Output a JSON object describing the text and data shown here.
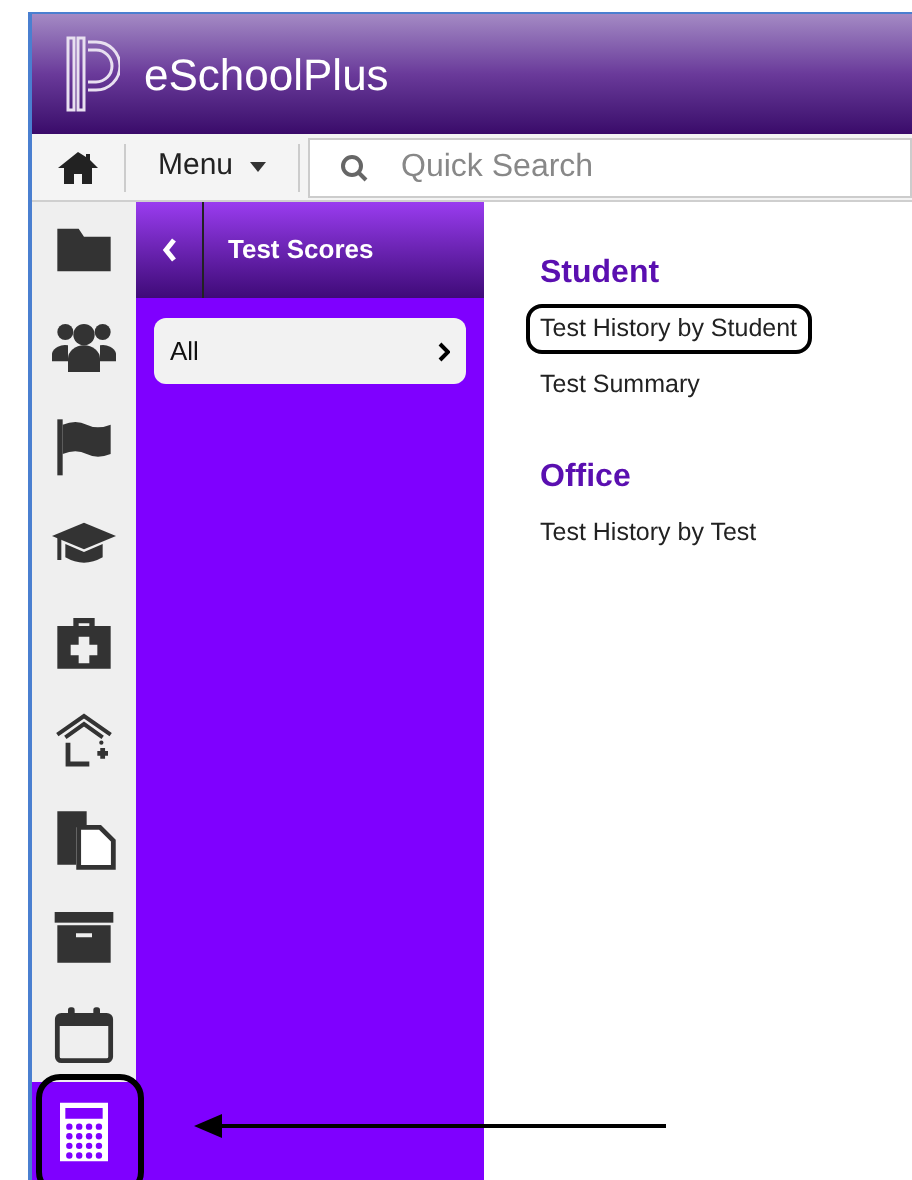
{
  "header": {
    "title": "eSchoolPlus"
  },
  "toolbar": {
    "menu_label": "Menu",
    "search": {
      "placeholder": "Quick Search"
    }
  },
  "sidebar": {
    "items": [
      {
        "kind": "folder",
        "selected": false
      },
      {
        "kind": "people",
        "selected": false
      },
      {
        "kind": "flag",
        "selected": false
      },
      {
        "kind": "cap",
        "selected": false
      },
      {
        "kind": "medkit",
        "selected": false
      },
      {
        "kind": "house",
        "selected": false
      },
      {
        "kind": "documents",
        "selected": false
      },
      {
        "kind": "archive",
        "selected": false
      },
      {
        "kind": "calendar",
        "selected": false
      },
      {
        "kind": "calculator",
        "selected": true,
        "circled": true
      }
    ]
  },
  "panel": {
    "title": "Test Scores",
    "items": [
      {
        "label": "All"
      }
    ]
  },
  "sections": [
    {
      "heading": "Student",
      "links": [
        {
          "label": "Test History by Student",
          "circled": true
        },
        {
          "label": "Test Summary",
          "circled": false
        }
      ]
    },
    {
      "heading": "Office",
      "links": [
        {
          "label": "Test History by Test",
          "circled": false
        }
      ]
    }
  ]
}
